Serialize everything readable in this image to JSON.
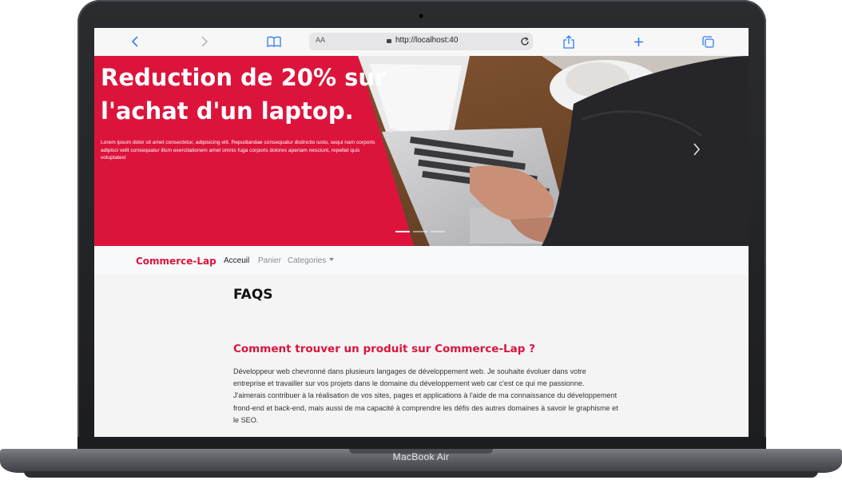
{
  "device": {
    "label": "MacBook Air"
  },
  "browser": {
    "text_size_label": "AA",
    "url": "http://localhost:40"
  },
  "hero": {
    "title": "Reduction de 20% sur l'achat d'un laptop.",
    "text": "Lorem ipsum dolor sit amet consectetur, adipisicing elit. Repudiandae consequatur distinctio iusto, sequi nam corporis adipisci velit consequatur illum exercitationem amet omnis fuga corporis dolores aperiam nesciunt, repellat quis voluptates!",
    "next_icon": "chevron-right-icon",
    "slides_count": 3,
    "active_slide": 1
  },
  "navbar": {
    "brand": "Commerce-Lap",
    "items": [
      {
        "label": "Acceuil",
        "active": true
      },
      {
        "label": "Panier",
        "active": false
      },
      {
        "label": "Categories",
        "active": false,
        "dropdown": true
      }
    ]
  },
  "content": {
    "title": "FAQS",
    "faqs": [
      {
        "question": "Comment trouver un produit sur Commerce-Lap ?",
        "answer": "Développeur web chevronné dans plusieurs langages de développement web. Je souhaite évoluer dans votre entreprise et travailler sur vos projets dans le domaine du développement web car c'est ce qui me passionne. J'aimerais contribuer à la réalisation de vos sites, pages et applications à l'aide de ma connaissance du développement frond-end et back-end, mais aussi de ma capacité à comprendre les défis des autres domaines à savoir le graphisme et le SEO."
      }
    ]
  },
  "colors": {
    "accent": "#dc143c",
    "browser_blue": "#2f7cf6"
  }
}
